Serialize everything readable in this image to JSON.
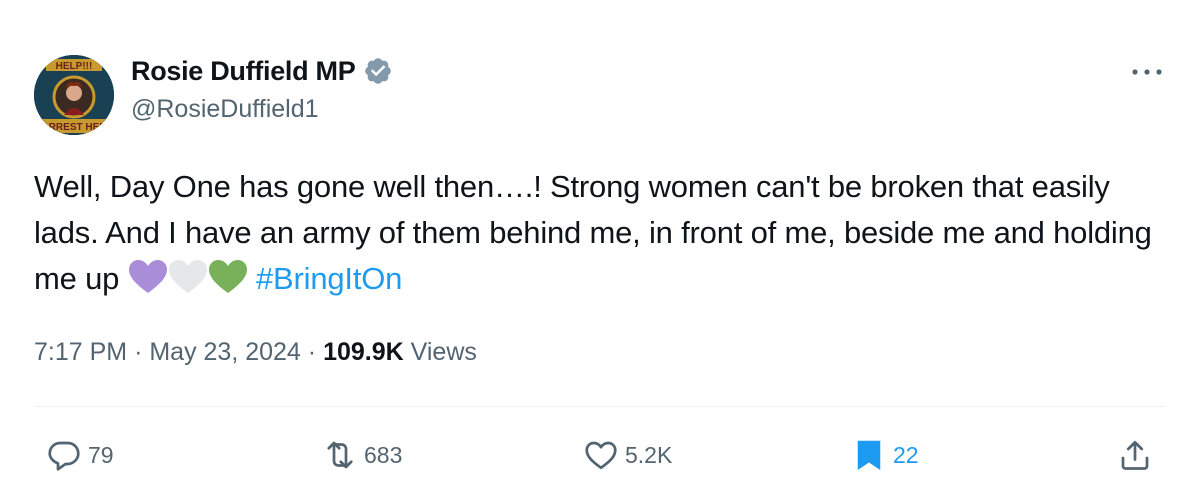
{
  "author": {
    "name": "Rosie Duffield MP",
    "handle": "@RosieDuffield1",
    "avatar_top_text": "HELP!!!",
    "avatar_bottom_text": "ARREST HER"
  },
  "tweet": {
    "text": "Well, Day One has gone well then….! Strong women can't be broken that easily lads. And I have an army of them behind me, in front of me, beside me and holding me up",
    "emojis": [
      "purple-heart",
      "white-heart",
      "green-heart"
    ],
    "hashtag": "#BringItOn"
  },
  "meta": {
    "time": "7:17 PM",
    "separator": "·",
    "date": "May 23, 2024",
    "views_count": "109.9K",
    "views_label": "Views"
  },
  "actions": {
    "replies": "79",
    "reposts": "683",
    "likes": "5.2K",
    "bookmarks": "22"
  },
  "colors": {
    "link": "#1d9bf0",
    "secondary_text": "#536471",
    "purple_heart": "#a98dd8",
    "white_heart": "#e6e7e8",
    "green_heart": "#78b159"
  }
}
